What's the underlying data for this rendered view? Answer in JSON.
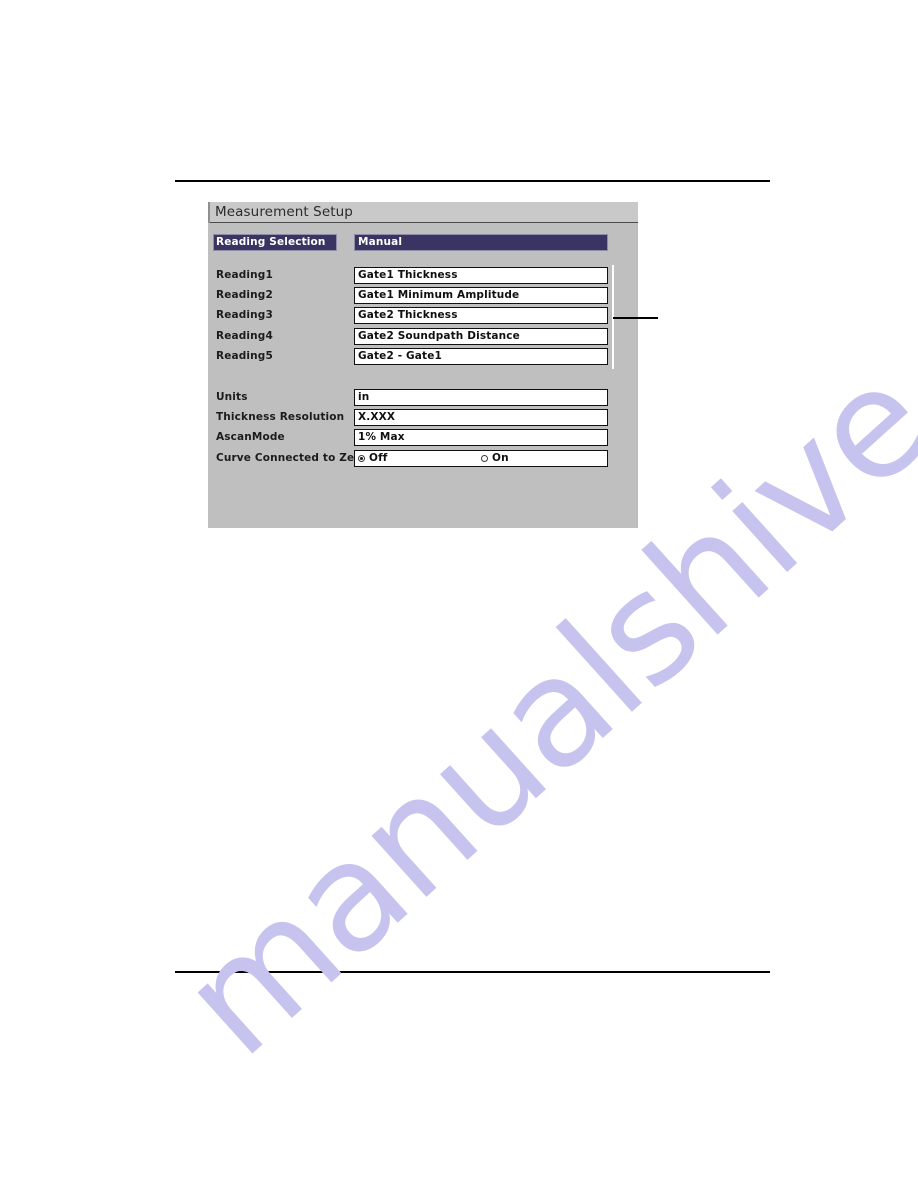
{
  "page": {
    "rules": {
      "top_label": "page-rule-top",
      "bottom_label": "page-rule-bottom"
    },
    "watermark": {
      "text": "manualshive.com",
      "color": "#c6c4ef"
    }
  },
  "dialog": {
    "title": "Measurement Setup",
    "colors": {
      "body": "#bfbfbf",
      "titlebar": "#c9c9c9",
      "selected": "#3a3463",
      "field_bg": "#ffffff",
      "field_border": "#111111",
      "text": "#1c1c1c",
      "selected_text": "#ffffff"
    },
    "selected_row": {
      "label": "Reading Selection",
      "value": "Manual"
    },
    "reading_rows": [
      {
        "label": "Reading1",
        "value": "Gate1 Thickness"
      },
      {
        "label": "Reading2",
        "value": "Gate1 Minimum Amplitude"
      },
      {
        "label": "Reading3",
        "value": "Gate2 Thickness"
      },
      {
        "label": "Reading4",
        "value": "Gate2 Soundpath Distance"
      },
      {
        "label": "Reading5",
        "value": "Gate2 - Gate1"
      }
    ],
    "setting_rows": [
      {
        "label": "Units",
        "value": "in"
      },
      {
        "label": "Thickness Resolution",
        "value": "X.XXX"
      },
      {
        "label": "AscanMode",
        "value": "1% Max"
      }
    ],
    "radio_row": {
      "label": "Curve Connected to Zero",
      "options": [
        {
          "label": "Off",
          "selected": true
        },
        {
          "label": "On",
          "selected": false
        }
      ]
    }
  }
}
